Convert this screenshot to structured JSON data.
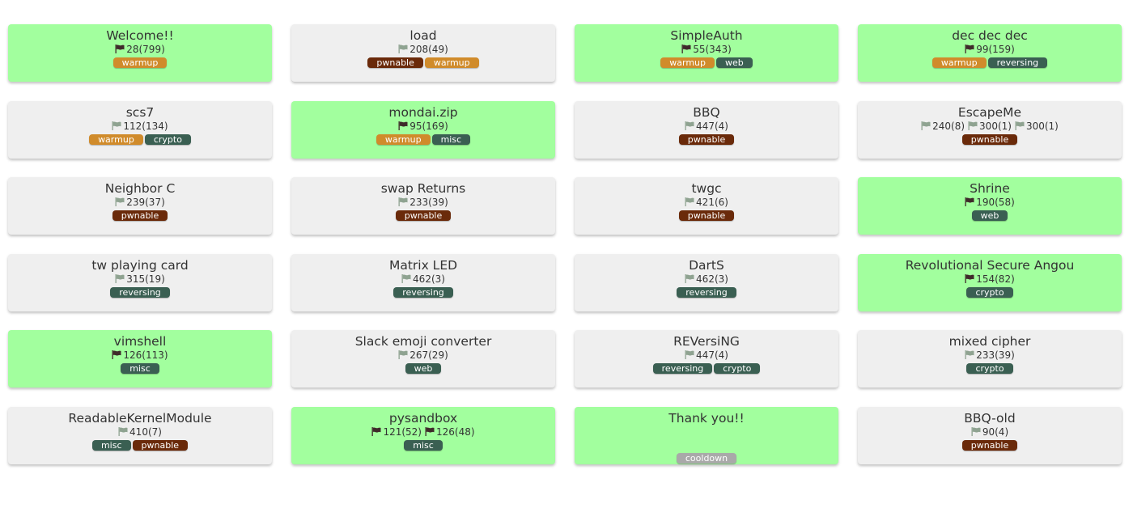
{
  "colors": {
    "solved_card": "#a2ff9e",
    "unsolved_card": "#efefef",
    "flag_solved": "#3f2a2a",
    "flag_unsolved": "#8fa391",
    "tag": {
      "warmup": "#d08b2b",
      "pwnable": "#6a2a0a",
      "web": "#3a5f52",
      "crypto": "#3a5f52",
      "misc": "#3a5f52",
      "reversing": "#3a5f52",
      "cooldown": "#a9a9a9"
    }
  },
  "challenges": [
    {
      "title": "Welcome!!",
      "solved": true,
      "scores": [
        {
          "text": "28(799)",
          "solved": true
        }
      ],
      "tags": [
        "warmup"
      ]
    },
    {
      "title": "load",
      "solved": false,
      "scores": [
        {
          "text": "208(49)",
          "solved": false
        }
      ],
      "tags": [
        "pwnable",
        "warmup"
      ]
    },
    {
      "title": "SimpleAuth",
      "solved": true,
      "scores": [
        {
          "text": "55(343)",
          "solved": true
        }
      ],
      "tags": [
        "warmup",
        "web"
      ]
    },
    {
      "title": "dec dec dec",
      "solved": true,
      "scores": [
        {
          "text": "99(159)",
          "solved": true
        }
      ],
      "tags": [
        "warmup",
        "reversing"
      ]
    },
    {
      "title": "scs7",
      "solved": false,
      "scores": [
        {
          "text": "112(134)",
          "solved": false
        }
      ],
      "tags": [
        "warmup",
        "crypto"
      ]
    },
    {
      "title": "mondai.zip",
      "solved": true,
      "scores": [
        {
          "text": "95(169)",
          "solved": true
        }
      ],
      "tags": [
        "warmup",
        "misc"
      ]
    },
    {
      "title": "BBQ",
      "solved": false,
      "scores": [
        {
          "text": "447(4)",
          "solved": false
        }
      ],
      "tags": [
        "pwnable"
      ]
    },
    {
      "title": "EscapeMe",
      "solved": false,
      "scores": [
        {
          "text": "240(8)",
          "solved": false
        },
        {
          "text": "300(1)",
          "solved": false
        },
        {
          "text": "300(1)",
          "solved": false
        }
      ],
      "tags": [
        "pwnable"
      ]
    },
    {
      "title": "Neighbor C",
      "solved": false,
      "scores": [
        {
          "text": "239(37)",
          "solved": false
        }
      ],
      "tags": [
        "pwnable"
      ]
    },
    {
      "title": "swap Returns",
      "solved": false,
      "scores": [
        {
          "text": "233(39)",
          "solved": false
        }
      ],
      "tags": [
        "pwnable"
      ]
    },
    {
      "title": "twgc",
      "solved": false,
      "scores": [
        {
          "text": "421(6)",
          "solved": false
        }
      ],
      "tags": [
        "pwnable"
      ]
    },
    {
      "title": "Shrine",
      "solved": true,
      "scores": [
        {
          "text": "190(58)",
          "solved": true
        }
      ],
      "tags": [
        "web"
      ]
    },
    {
      "title": "tw playing card",
      "solved": false,
      "scores": [
        {
          "text": "315(19)",
          "solved": false
        }
      ],
      "tags": [
        "reversing"
      ]
    },
    {
      "title": "Matrix LED",
      "solved": false,
      "scores": [
        {
          "text": "462(3)",
          "solved": false
        }
      ],
      "tags": [
        "reversing"
      ]
    },
    {
      "title": "DartS",
      "solved": false,
      "scores": [
        {
          "text": "462(3)",
          "solved": false
        }
      ],
      "tags": [
        "reversing"
      ]
    },
    {
      "title": "Revolutional Secure Angou",
      "solved": true,
      "scores": [
        {
          "text": "154(82)",
          "solved": true
        }
      ],
      "tags": [
        "crypto"
      ]
    },
    {
      "title": "vimshell",
      "solved": true,
      "scores": [
        {
          "text": "126(113)",
          "solved": true
        }
      ],
      "tags": [
        "misc"
      ]
    },
    {
      "title": "Slack emoji converter",
      "solved": false,
      "scores": [
        {
          "text": "267(29)",
          "solved": false
        }
      ],
      "tags": [
        "web"
      ]
    },
    {
      "title": "REVersiNG",
      "solved": false,
      "scores": [
        {
          "text": "447(4)",
          "solved": false
        }
      ],
      "tags": [
        "reversing",
        "crypto"
      ]
    },
    {
      "title": "mixed cipher",
      "solved": false,
      "scores": [
        {
          "text": "233(39)",
          "solved": false
        }
      ],
      "tags": [
        "crypto"
      ]
    },
    {
      "title": "ReadableKernelModule",
      "solved": false,
      "scores": [
        {
          "text": "410(7)",
          "solved": false
        }
      ],
      "tags": [
        "misc",
        "pwnable"
      ]
    },
    {
      "title": "pysandbox",
      "solved": true,
      "scores": [
        {
          "text": "121(52)",
          "solved": true
        },
        {
          "text": "126(48)",
          "solved": true
        }
      ],
      "tags": [
        "misc"
      ]
    },
    {
      "title": "Thank you!!",
      "solved": true,
      "scores": [],
      "tags": [
        "cooldown"
      ]
    },
    {
      "title": "BBQ-old",
      "solved": false,
      "scores": [
        {
          "text": "90(4)",
          "solved": false
        }
      ],
      "tags": [
        "pwnable"
      ]
    }
  ]
}
